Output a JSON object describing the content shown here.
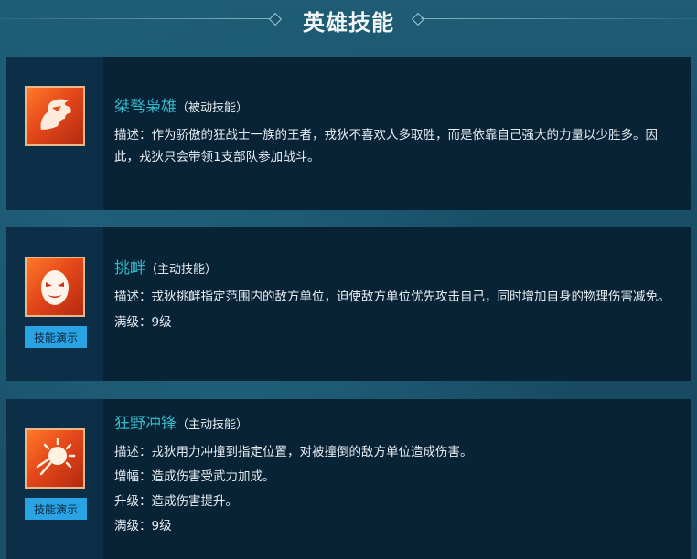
{
  "header": {
    "title": "英雄技能"
  },
  "skills": [
    {
      "name": "桀骜枭雄",
      "type": "（被动技能）",
      "icon": "beast-head-icon",
      "lines": [
        "描述：作为骄傲的狂战士一族的王者，戎狄不喜欢人多取胜，而是依靠自己强大的力量以少胜多。因此，戎狄只会带领1支部队参加战斗。"
      ]
    },
    {
      "name": "挑衅",
      "type": "（主动技能）",
      "icon": "mask-icon",
      "demo_label": "技能演示",
      "lines": [
        "描述：戎狄挑衅指定范围内的敌方单位，迫使敌方单位优先攻击自己，同时增加自身的物理伤害减免。",
        "满级：9级"
      ]
    },
    {
      "name": "狂野冲锋",
      "type": "（主动技能）",
      "icon": "burst-icon",
      "demo_label": "技能演示",
      "lines": [
        "描述：戎狄用力冲撞到指定位置，对被撞倒的敌方单位造成伤害。",
        "增幅：造成伤害受武力加成。",
        "升级：造成伤害提升。",
        "满级：9级"
      ]
    }
  ]
}
